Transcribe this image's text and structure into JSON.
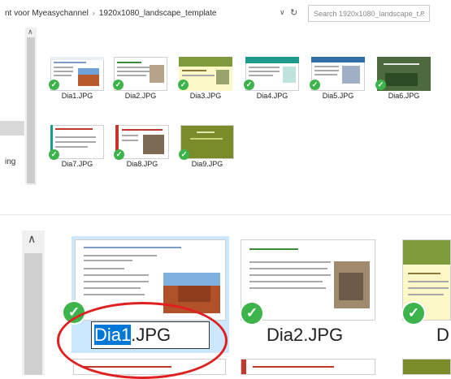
{
  "breadcrumb": {
    "parent": "nt voor Myeasychannel",
    "folder": "1920x1080_landscape_template"
  },
  "search": {
    "placeholder": "Search 1920x1080_landscape_t..."
  },
  "nav": {
    "partial_item": "ing"
  },
  "files": [
    {
      "name": "Dia1.JPG"
    },
    {
      "name": "Dia2.JPG"
    },
    {
      "name": "Dia3.JPG"
    },
    {
      "name": "Dia4.JPG"
    },
    {
      "name": "Dia5.JPG"
    },
    {
      "name": "Dia6.JPG"
    },
    {
      "name": "Dia7.JPG"
    },
    {
      "name": "Dia8.JPG"
    },
    {
      "name": "Dia9.JPG"
    }
  ],
  "zoom": {
    "rename_selected": "Dia1",
    "rename_rest": ".JPG",
    "caption2": "Dia2.JPG",
    "caption3": "D"
  },
  "colors": {
    "sync_check": "#3cb44b",
    "selection": "#cce8ff",
    "annotation": "#e02020",
    "text_highlight": "#0078d7"
  },
  "icons": [
    "chevron-down-icon",
    "refresh-icon",
    "search-icon",
    "scroll-up-icon",
    "check-icon"
  ]
}
